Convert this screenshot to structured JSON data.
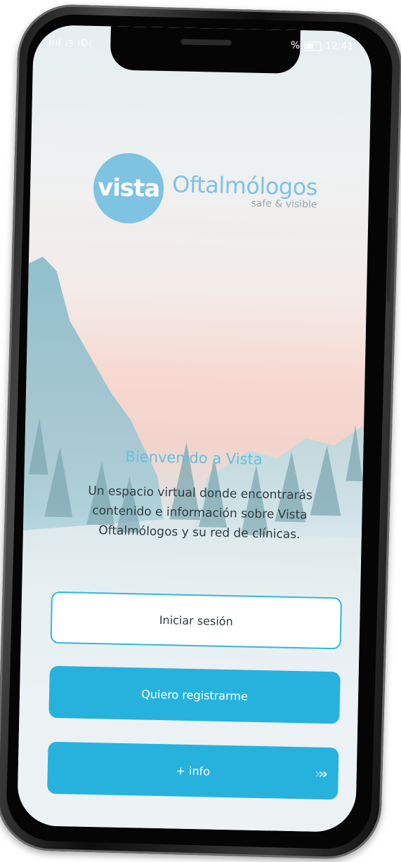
{
  "status_bar": {
    "left_icons": "ıııl ◷ ıO(",
    "signal_percent": "%",
    "time": "12:41"
  },
  "logo": {
    "circle_text": "vista",
    "name": "Oftalmólogos",
    "tagline": "safe & visible",
    "brand_color": "#7ec3e2"
  },
  "welcome": {
    "title": "Bienvenido a Vista",
    "body": "Un espacio virtual donde encontrarás contenido e información sobre Vista Oftalmólogos y su red de clínicas."
  },
  "buttons": {
    "login_label": "Iniciar sesión",
    "register_label": "Quiero registrarme",
    "info_label": "+ info",
    "info_chevrons": "›››"
  },
  "colors": {
    "accent": "#27b2de",
    "title_text": "#5fc2e0",
    "body_text": "#2e3b40"
  }
}
